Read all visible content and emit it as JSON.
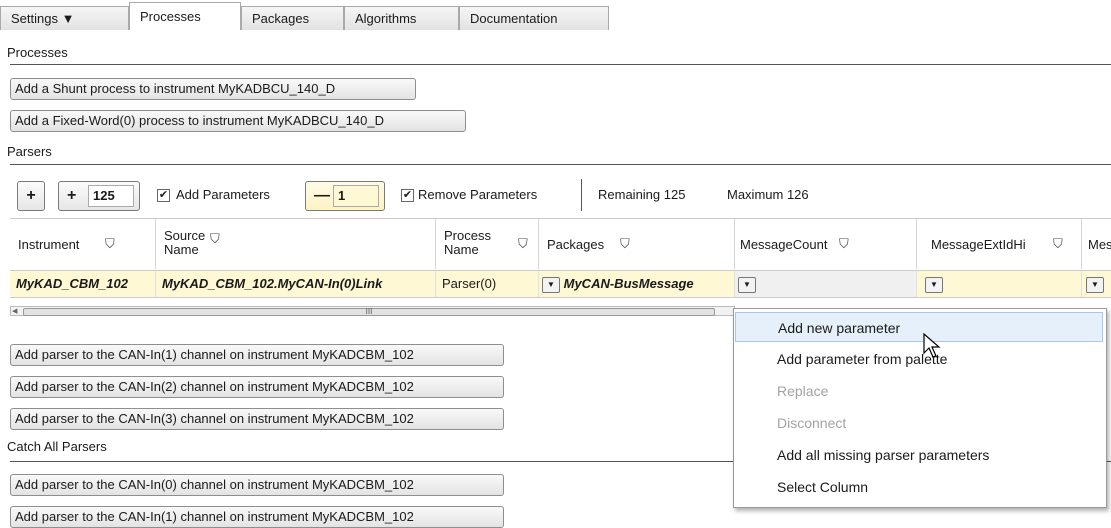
{
  "tabs": [
    {
      "label": "Settings ▼"
    },
    {
      "label": "Processes"
    },
    {
      "label": "Packages"
    },
    {
      "label": "Algorithms"
    },
    {
      "label": "Documentation"
    }
  ],
  "sections": {
    "processes": "Processes",
    "parsers": "Parsers",
    "catch_all": "Catch All Parsers"
  },
  "process_buttons": [
    "Add a Shunt process to instrument MyKADBCU_140_D",
    "Add a Fixed-Word(0) process to instrument MyKADBCU_140_D"
  ],
  "toolbar": {
    "plus": "+",
    "plus_count_label": "+",
    "add_count": "125",
    "add_params_label": "Add Parameters",
    "minus": "—",
    "remove_count": "1",
    "remove_params_label": "Remove Parameters",
    "remaining": "Remaining 125",
    "maximum": "Maximum 126"
  },
  "grid": {
    "columns": [
      {
        "label": "Instrument"
      },
      {
        "label": "Source Name"
      },
      {
        "label": "Process Name"
      },
      {
        "label": "Packages"
      },
      {
        "label": "MessageCount"
      },
      {
        "label": "MessageExtIdHi"
      },
      {
        "label": "Mes"
      }
    ],
    "row": {
      "instrument": "MyKAD_CBM_102",
      "source_name": "MyKAD_CBM_102.MyCAN-In(0)Link",
      "process_name": "Parser(0)",
      "packages": "MyCAN-BusMessage"
    },
    "scroll_marker": "III"
  },
  "parser_buttons": [
    "Add parser to the CAN-In(1) channel on instrument MyKADCBM_102",
    "Add parser to the CAN-In(2) channel on instrument MyKADCBM_102",
    "Add parser to the CAN-In(3) channel on instrument MyKADCBM_102"
  ],
  "catch_all_buttons": [
    "Add parser to the CAN-In(0) channel on instrument MyKADCBM_102",
    "Add parser to the CAN-In(1) channel on instrument MyKADCBM_102"
  ],
  "context_menu": {
    "items": [
      {
        "label": "Add new parameter",
        "state": "highlighted"
      },
      {
        "label": "Add parameter from palette",
        "state": "enabled"
      },
      {
        "label": "Replace",
        "state": "disabled"
      },
      {
        "label": "Disconnect",
        "state": "disabled"
      },
      {
        "label": "Add all missing parser parameters",
        "state": "enabled"
      },
      {
        "label": "Select Column",
        "state": "enabled"
      }
    ]
  },
  "icons": {
    "filter": "filter-funnel-icon",
    "dropdown": "dropdown-arrow-icon",
    "cursor": "mouse-pointer-icon",
    "checkbox": "checked-checkbox-icon"
  }
}
